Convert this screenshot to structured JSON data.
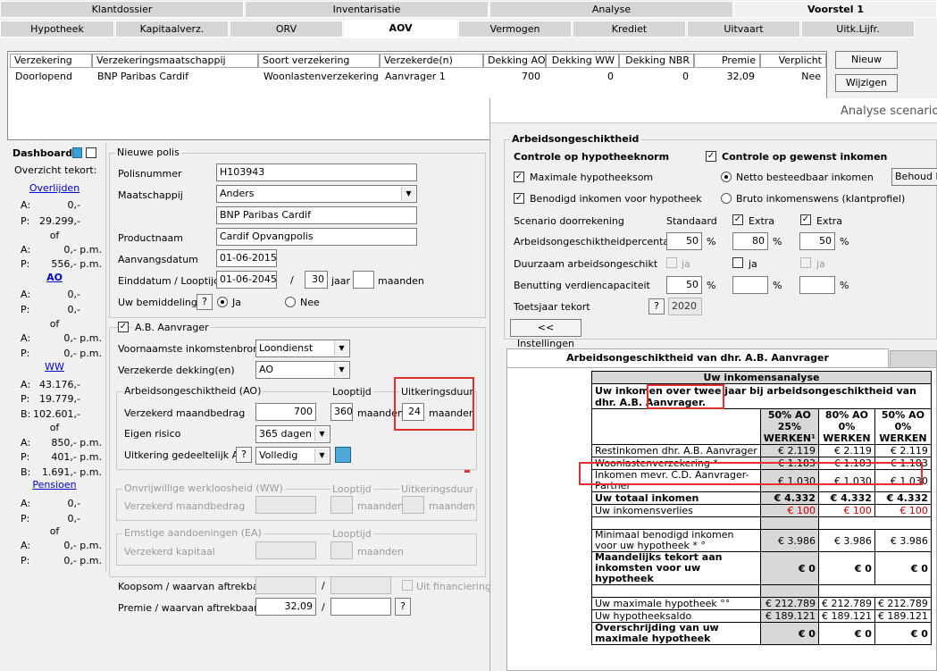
{
  "tabs_top": [
    {
      "label": "Klantdossier"
    },
    {
      "label": "Inventarisatie"
    },
    {
      "label": "Analyse"
    },
    {
      "label": "Voorstel 1"
    }
  ],
  "tabs_sub": [
    {
      "label": "Hypotheek"
    },
    {
      "label": "Kapitaalverz."
    },
    {
      "label": "ORV"
    },
    {
      "label": "AOV"
    },
    {
      "label": "Vermogen"
    },
    {
      "label": "Krediet"
    },
    {
      "label": "Uitvaart"
    },
    {
      "label": "Uitk.Lijfr."
    }
  ],
  "grid": {
    "headers": [
      "Verzekering",
      "Verzekeringsmaatschappij",
      "Soort verzekering",
      "Verzekerde(n)",
      "Dekking AO",
      "Dekking WW",
      "Dekking NBR",
      "Premie",
      "Verplicht"
    ],
    "row": [
      "Doorlopend",
      "BNP Paribas Cardif",
      "Woonlastenverzekering",
      "Aanvrager 1",
      "700",
      "0",
      "0",
      "32,09",
      "Nee"
    ]
  },
  "buttons": {
    "nieuw": "Nieuw",
    "wijzigen": "Wijzigen"
  },
  "dashboard": {
    "title": "Dashboard",
    "subtitle": "Overzicht tekort:",
    "overlijden": {
      "link": "Overlijden",
      "a": "0,-",
      "p": "29.299,-",
      "of": "of",
      "a2": "0,- p.m.",
      "p2": "556,- p.m."
    },
    "ao": {
      "link": "AO",
      "a": "0,-",
      "p": "0,-",
      "of": "of",
      "a2": "0,- p.m.",
      "p2": "0,- p.m."
    },
    "ww": {
      "link": "WW",
      "a": "43.176,-",
      "p": "19.779,-",
      "b": "102.601,-",
      "of": "of",
      "a2": "850,- p.m.",
      "p2": "401,- p.m.",
      "b2": "1.691,- p.m."
    },
    "pensioen": {
      "link": "Pensioen",
      "a": "0,-",
      "p": "0,-",
      "of": "of",
      "a2": "0,- p.m.",
      "p2": "0,- p.m."
    },
    "keys": {
      "a": "A:",
      "p": "P:",
      "b": "B:"
    }
  },
  "polis": {
    "caption": "Nieuwe polis",
    "polisnummer_label": "Polisnummer",
    "polisnummer": "H103943",
    "maatschappij_label": "Maatschappij",
    "maatschappij": "Anders",
    "maatschappij2": "BNP Paribas Cardif",
    "productnaam_label": "Productnaam",
    "productnaam": "Cardif Opvangpolis",
    "aanvangsdatum_label": "Aanvangsdatum",
    "aanvangsdatum": "01-06-2015",
    "einddatum_label": "Einddatum / Looptijd",
    "einddatum": "01-06-2045",
    "slash": "/",
    "looptijd_jaar": "30",
    "jaar": "jaar",
    "maanden": "maanden",
    "bemiddeling_label": "Uw bemiddeling",
    "q": "?",
    "ja": "Ja",
    "nee": "Nee"
  },
  "ab": {
    "caption": "A.B. Aanvrager",
    "inkomstenbron_label": "Voornaamste inkomstenbron",
    "inkomstenbron": "Loondienst",
    "dekking_label": "Verzekerde dekking(en)",
    "dekking": "AO",
    "ao_caption": "Arbeidsongeschiktheid (AO)",
    "looptijd": "Looptijd",
    "uitkeringsduur": "Uitkeringsduur",
    "maandbedrag_label": "Verzekerd maandbedrag",
    "maandbedrag": "700",
    "looptijd_val": "360",
    "maanden": "maanden",
    "uitkeringsduur_val": "24",
    "eigen_risico_label": "Eigen risico",
    "eigen_risico": "365 dagen",
    "gedeeltelijk_label": "Uitkering gedeeltelijk AO",
    "gedeeltelijk": "Volledig",
    "ww_caption": "Onvrijwillige werkloosheid (WW)",
    "ww_maandbedrag_label": "Verzekerd maandbedrag",
    "ea_caption": "Ernstige aandoeningen (EA)",
    "ea_kapitaal_label": "Verzekerd kapitaal",
    "koopsom_label": "Koopsom / waarvan aftrekbaar",
    "uit_financiering": "Uit financiering",
    "premie_label": "Premie / waarvan aftrekbaar",
    "premie": "32,09"
  },
  "scenario": {
    "title": "Analyse scenario",
    "group": "Arbeidsongeschiktheid",
    "norm": "Controle op hypotheeknorm",
    "gewenst": "Controle op gewenst inkomen",
    "max_hyp": "Maximale hypotheeksom",
    "netto": "Netto besteedbaar inkomen",
    "behoud": "Behoud h",
    "benodigd": "Benodigd inkomen voor hypotheek",
    "bruto": "Bruto inkomenswens (klantprofiel)",
    "doorrekening": "Scenario doorrekening",
    "standaard": "Standaard",
    "extra1": "Extra",
    "extra2": "Extra",
    "perc_label": "Arbeidsongeschiktheidpercentage",
    "p1": "50",
    "p2": "80",
    "p3": "50",
    "pct": "%",
    "duurzaam": "Duurzaam arbeidsongeschikt",
    "ja": "ja",
    "benutting": "Benutting verdiencapaciteit",
    "b1": "50",
    "toetsjaar": "Toetsjaar tekort",
    "toetsjaar_val": "2020",
    "instellingen": "<< Instellingen",
    "tab": "Arbeidsongeschiktheid van dhr. A.B. Aanvrager"
  },
  "analyse": {
    "title": "Uw inkomensanalyse",
    "intro": "Uw inkomen over twee jaar bij arbeidsongeschiktheid van dhr. A.B. Aanvrager.",
    "cols": [
      {
        "h1": "50% AO",
        "h2": "25%",
        "h3": "WERKEN¹"
      },
      {
        "h1": "80% AO",
        "h2": "0%",
        "h3": "WERKEN"
      },
      {
        "h1": "50% AO",
        "h2": "0%",
        "h3": "WERKEN"
      }
    ],
    "rows": [
      {
        "label": "Restinkomen dhr. A.B. Aanvrager",
        "v": [
          "€ 2.119",
          "€ 2.119",
          "€ 2.119"
        ]
      },
      {
        "label": "Woonlastenverzekering *",
        "v": [
          "€ 1.183",
          "€ 1.183",
          "€ 1.183"
        ]
      },
      {
        "label": "Inkomen mevr. C.D. Aanvrager-Partner",
        "v": [
          "€ 1.030",
          "€ 1.030",
          "€ 1.030"
        ]
      },
      {
        "label": "Uw totaal inkomen",
        "v": [
          "€ 4.332",
          "€ 4.332",
          "€ 4.332"
        ]
      },
      {
        "label": "Uw inkomensverlies",
        "v": [
          "€ 100",
          "€ 100",
          "€ 100"
        ]
      },
      {
        "label": "Minimaal benodigd inkomen voor uw hypotheek * °",
        "v": [
          "€ 3.986",
          "€ 3.986",
          "€ 3.986"
        ]
      },
      {
        "label": "Maandelijks tekort aan inkomsten voor uw hypotheek",
        "v": [
          "€ 0",
          "€ 0",
          "€ 0"
        ]
      },
      {
        "label": "Uw maximale hypotheek °°",
        "v": [
          "€ 212.789",
          "€ 212.789",
          "€ 212.789"
        ]
      },
      {
        "label": "Uw hypotheeksaldo",
        "v": [
          "€ 189.121",
          "€ 189.121",
          "€ 189.121"
        ]
      },
      {
        "label": "Overschrijding van uw maximale hypotheek",
        "v": [
          "€ 0",
          "€ 0",
          "€ 0"
        ]
      }
    ]
  },
  "colors": {
    "highlight": "#e03030",
    "loss": "#d00000"
  }
}
